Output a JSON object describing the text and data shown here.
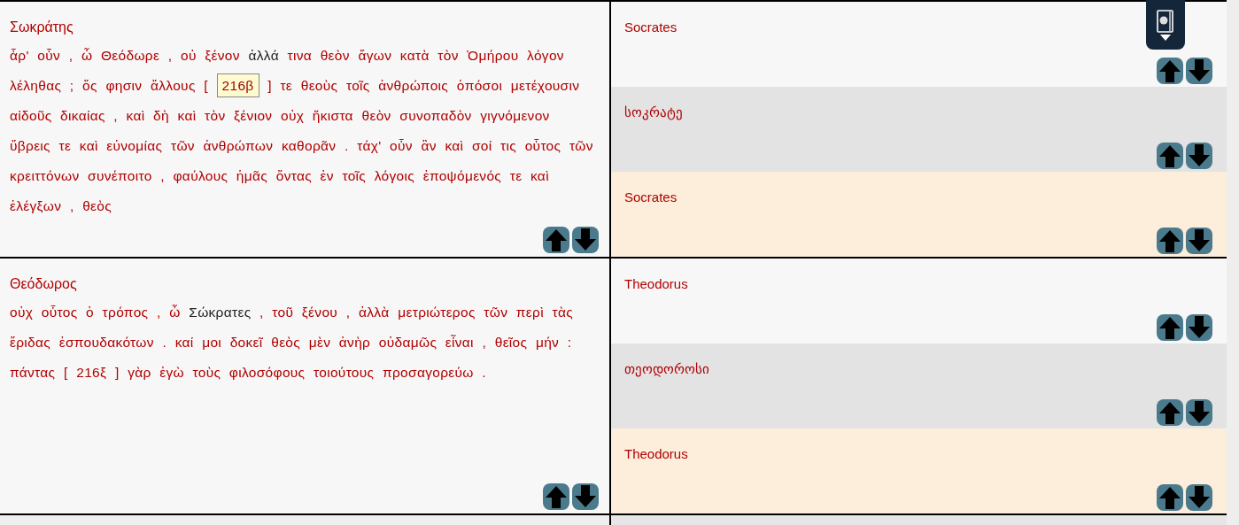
{
  "turns": [
    {
      "greek": {
        "speaker": "Σωκράτης",
        "segments": [
          {
            "kind": "text",
            "text": "ἆρ' οὖν , ὦ Θεόδωρε , οὐ ξένον"
          },
          {
            "kind": "name",
            "text": "ἀλλά"
          },
          {
            "kind": "text",
            "text": "τινα θεὸν ἄγων κατὰ τὸν Ὁμήρου λόγον λέληθας ; ὅς φησιν ἄλλους ["
          },
          {
            "kind": "page_ref",
            "text": "216β",
            "highlighted": true
          },
          {
            "kind": "text",
            "text": "] τε θεοὺς τοῖς ἀνθρώποις ὁπόσοι μετέχουσιν αἰδοῦς δικαίας , καὶ δὴ καὶ τὸν ξένιον οὐχ ἥκιστα θεὸν συνοπαδὸν γιγνόμενον ὕβρεις τε καὶ εὐνομίας τῶν ἀνθρώπων καθορᾶν . τάχ' οὖν ἂν καὶ σοί τις οὗτος τῶν κρειττόνων συνέποιτο , φαύλους ἡμᾶς ὄντας ἐν τοῖς λόγοις ἐποψόμενός τε καὶ ἐλέγξων , θεὸς"
          }
        ]
      },
      "translations": [
        {
          "kind": "english",
          "speaker": "Socrates"
        },
        {
          "kind": "georgian",
          "speaker": "სოკრატე"
        },
        {
          "kind": "variant",
          "speaker": "Socrates"
        }
      ]
    },
    {
      "greek": {
        "speaker": "Θεόδωρος",
        "segments": [
          {
            "kind": "text",
            "text": "οὐχ οὗτος ὁ τρόπος , ὦ"
          },
          {
            "kind": "name",
            "text": "Σώκρατες"
          },
          {
            "kind": "text",
            "text": ", τοῦ ξένου , ἀλλὰ μετριώτερος τῶν περὶ τὰς ἔριδας ἐσπουδακότων . καί μοι δοκεῖ θεὸς μὲν ἀνὴρ οὐδαμῶς εἶναι , θεῖος μήν : πάντας"
          },
          {
            "kind": "page_ref",
            "text": "[ 216ξ ]",
            "highlighted": false
          },
          {
            "kind": "text",
            "text": "γὰρ ἐγὼ τοὺς φιλοσόφους τοιούτους προσαγορεύω ."
          }
        ]
      },
      "translations": [
        {
          "kind": "english",
          "speaker": "Theodorus"
        },
        {
          "kind": "georgian",
          "speaker": "თეოდოროსი"
        },
        {
          "kind": "variant",
          "speaker": "Theodorus"
        }
      ]
    }
  ]
}
